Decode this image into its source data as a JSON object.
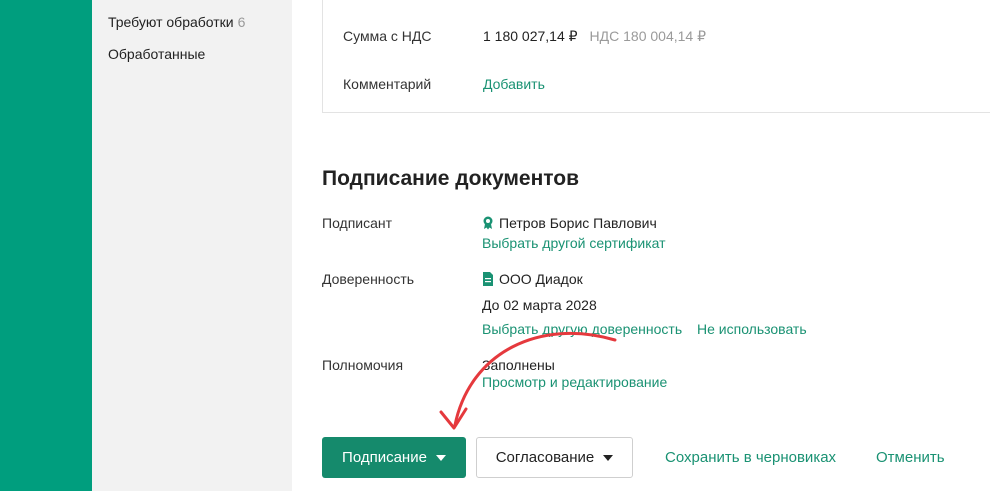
{
  "sidebar": {
    "items": [
      {
        "label": "Требуют обработки",
        "count": "6"
      },
      {
        "label": "Обработанные"
      }
    ]
  },
  "summary": {
    "vat_total_label": "Сумма с НДС",
    "vat_total_value": "1 180 027,14 ₽",
    "vat_amount": "НДС 180 004,14 ₽",
    "comment_label": "Комментарий",
    "comment_add": "Добавить"
  },
  "signing": {
    "title": "Подписание документов",
    "signer_label": "Подписант",
    "signer_name": "Петров Борис Павлович",
    "signer_change_cert": "Выбрать другой сертификат",
    "poa_label": "Доверенность",
    "poa_org": "ООО Диадок",
    "poa_valid_until": "До 02 марта 2028",
    "poa_change": "Выбрать другую доверенность",
    "poa_dont_use": "Не использовать",
    "powers_label": "Полномочия",
    "powers_status": "Заполнены",
    "powers_edit": "Просмотр и редактирование"
  },
  "actions": {
    "sign": "Подписание",
    "approve": "Согласование",
    "save_draft": "Сохранить в черновиках",
    "cancel": "Отменить"
  },
  "colors": {
    "brand": "#009e7e",
    "link": "#1a9273",
    "primary_button": "#158a6c",
    "annotation_arrow": "#e5393d"
  },
  "icons": {
    "signer": "certificate-icon",
    "poa": "document-icon"
  }
}
